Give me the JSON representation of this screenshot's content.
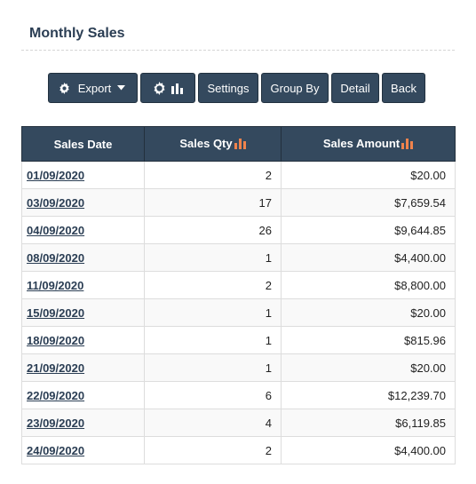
{
  "page": {
    "title": "Monthly Sales"
  },
  "toolbar": {
    "export_label": "Export",
    "settings_label": "Settings",
    "groupby_label": "Group By",
    "detail_label": "Detail",
    "back_label": "Back"
  },
  "table": {
    "columns": {
      "date": "Sales Date",
      "qty": "Sales Qty",
      "amount": "Sales Amount"
    },
    "rows": [
      {
        "date": "01/09/2020",
        "qty": "2",
        "amount": "$20.00"
      },
      {
        "date": "03/09/2020",
        "qty": "17",
        "amount": "$7,659.54"
      },
      {
        "date": "04/09/2020",
        "qty": "26",
        "amount": "$9,644.85"
      },
      {
        "date": "08/09/2020",
        "qty": "1",
        "amount": "$4,400.00"
      },
      {
        "date": "11/09/2020",
        "qty": "2",
        "amount": "$8,800.00"
      },
      {
        "date": "15/09/2020",
        "qty": "1",
        "amount": "$20.00"
      },
      {
        "date": "18/09/2020",
        "qty": "1",
        "amount": "$815.96"
      },
      {
        "date": "21/09/2020",
        "qty": "1",
        "amount": "$20.00"
      },
      {
        "date": "22/09/2020",
        "qty": "6",
        "amount": "$12,239.70"
      },
      {
        "date": "23/09/2020",
        "qty": "4",
        "amount": "$6,119.85"
      },
      {
        "date": "24/09/2020",
        "qty": "2",
        "amount": "$4,400.00"
      }
    ]
  },
  "icons": {
    "gear": "gear-icon",
    "caret": "caret-down-icon",
    "chart": "bar-chart-icon",
    "sort": "sort-bars-icon"
  },
  "colors": {
    "header_bg": "#34495e",
    "title": "#2b3e54",
    "sort_icon": "#f0834c"
  }
}
